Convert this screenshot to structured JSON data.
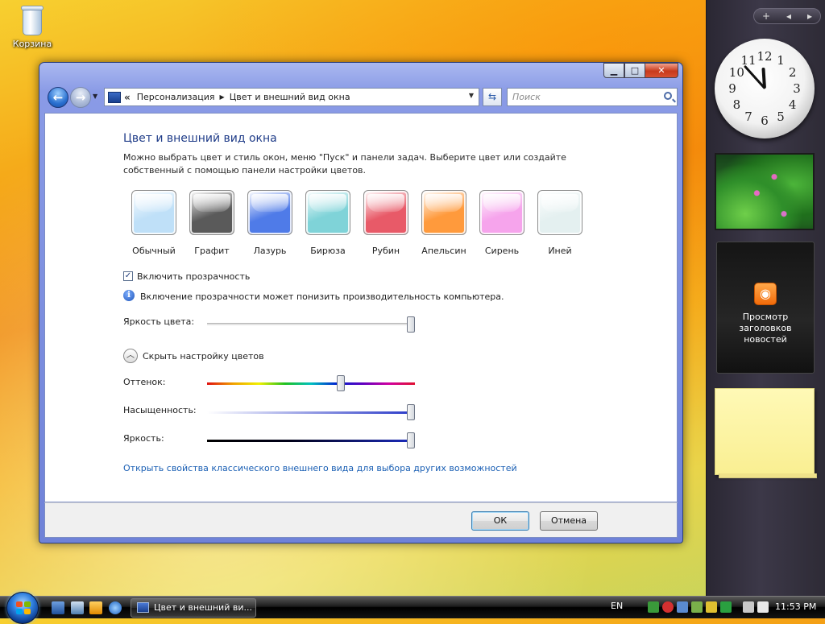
{
  "desktop": {
    "recycle_bin_label": "Корзина"
  },
  "window": {
    "controls": {
      "minimize": "▁",
      "maximize": "□",
      "close": "✕"
    },
    "address_bar": {
      "crumbs": [
        "Персонализация",
        "Цвет и внешний вид окна"
      ],
      "chevron": "«"
    },
    "search": {
      "placeholder": "Поиск"
    },
    "content": {
      "title": "Цвет и внешний вид окна",
      "description": "Можно выбрать цвет и стиль окон, меню \"Пуск\" и панели задач. Выберите цвет или создайте собственный с помощью панели настройки цветов.",
      "swatches": [
        {
          "label": "Обычный",
          "color": "#bfe0f8"
        },
        {
          "label": "Графит",
          "color": "#5a5a5a"
        },
        {
          "label": "Лазурь",
          "color": "#4f7be8"
        },
        {
          "label": "Бирюза",
          "color": "#7fd3d8"
        },
        {
          "label": "Рубин",
          "color": "#e85a68"
        },
        {
          "label": "Апельсин",
          "color": "#ff9a3c"
        },
        {
          "label": "Сирень",
          "color": "#f6a4ec"
        },
        {
          "label": "Иней",
          "color": "#e4f0f0"
        }
      ],
      "transparency_label": "Включить прозрачность",
      "transparency_checked": true,
      "info_text": "Включение прозрачности может понизить производительность компьютера.",
      "color_intensity_label": "Яркость цвета:",
      "color_intensity_value": 1.0,
      "mixer_toggle_label": "Скрыть настройку цветов",
      "hue_label": "Оттенок:",
      "hue_value": 0.65,
      "saturation_label": "Насыщенность:",
      "saturation_value": 1.0,
      "brightness_label": "Яркость:",
      "brightness_value": 1.0,
      "classic_link": "Открыть свойства классического внешнего вида для выбора других возможностей"
    },
    "footer": {
      "ok_label": "ОК",
      "cancel_label": "Отмена"
    }
  },
  "sidebar": {
    "controls": [
      "+",
      "◂",
      "▸"
    ],
    "clock_numbers": [
      "12",
      "1",
      "2",
      "3",
      "4",
      "5",
      "6",
      "7",
      "8",
      "9",
      "10",
      "11"
    ],
    "clock_time": {
      "hours": 11,
      "minutes": 53
    },
    "rss_title": "Просмотр заголовков новостей"
  },
  "taskbar": {
    "task_button_label": "Цвет и внешний ви...",
    "language": "EN",
    "time": "11:53 PM"
  },
  "colors": {
    "accent_blue": "#1f3c88",
    "link_blue": "#1a5fb4"
  }
}
